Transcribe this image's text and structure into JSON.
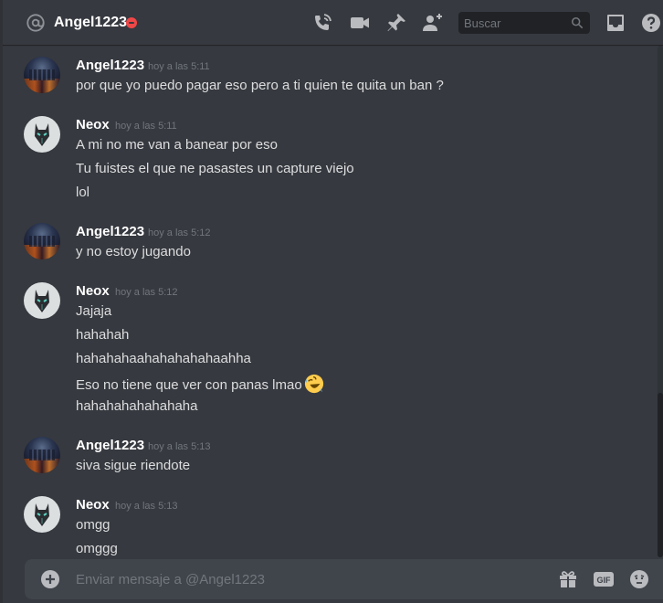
{
  "header": {
    "title": "Angel1223",
    "search_placeholder": "Buscar",
    "icons": [
      "at-icon",
      "dnd-status-icon",
      "call-icon",
      "video-icon",
      "pin-icon",
      "add-friend-icon",
      "search-icon",
      "inbox-icon",
      "help-icon"
    ]
  },
  "messages": [
    {
      "author": "Angel1223",
      "time": "hoy a las 5:11",
      "lines": [
        "por  que yo puedo pagar eso pero a ti quien te quita un ban ?"
      ]
    },
    {
      "author": "Neox",
      "time": "hoy a las 5:11",
      "lines": [
        "A mi no me van a banear por eso",
        "Tu fuistes el que ne pasastes un capture viejo",
        "lol"
      ]
    },
    {
      "author": "Angel1223",
      "time": "hoy a las 5:12",
      "lines": [
        "y no estoy jugando"
      ]
    },
    {
      "author": "Neox",
      "time": "hoy a las 5:12",
      "lines": [
        "Jajaja",
        "hahahah",
        "hahahahaahahahahahaahha",
        "Eso no tiene que ver con panas lmao",
        "hahahahahahahaha"
      ],
      "emoji": "rolling-on-floor-laughing-emoji"
    },
    {
      "author": "Angel1223",
      "time": "hoy a las 5:13",
      "lines": [
        "siva sigue riendote"
      ]
    },
    {
      "author": "Neox",
      "time": "hoy a las 5:13",
      "lines": [
        "omgg",
        "omggg"
      ]
    }
  ],
  "composer": {
    "placeholder": "Enviar mensaje a @Angel1223",
    "gif_label": "GIF",
    "icons": [
      "add-attachment-icon",
      "gift-icon",
      "gif-icon",
      "emoji-icon"
    ]
  },
  "colors": {
    "background": "#36393f",
    "input_bg": "#40444b",
    "dnd_red": "#f04747",
    "muted_text": "#72767d",
    "text": "#dcddde"
  }
}
